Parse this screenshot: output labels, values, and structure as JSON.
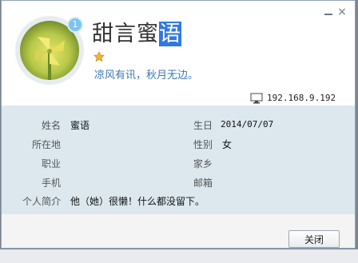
{
  "window": {
    "close_symbol": "×"
  },
  "profile": {
    "level": "1",
    "nickname_prefix": "甜言蜜",
    "nickname_highlighted": "语",
    "signature": "凉风有讯，秋月无边。",
    "ip": "192.168.9.192"
  },
  "fields": {
    "name_label": "姓名",
    "name_value": "蜜语",
    "location_label": "所在地",
    "location_value": "",
    "job_label": "职业",
    "job_value": "",
    "phone_label": "手机",
    "phone_value": "",
    "intro_label": "个人简介",
    "intro_value": "他（她）很懒！什么都没留下。",
    "birthday_label": "生日",
    "birthday_value": "2014/07/07",
    "gender_label": "性别",
    "gender_value": "女",
    "hometown_label": "家乡",
    "hometown_value": "",
    "email_label": "邮箱",
    "email_value": ""
  },
  "footer": {
    "close_label": "关闭"
  },
  "colors": {
    "panel_bg": "#dce8ee",
    "signature": "#3c78b5",
    "highlight": "#3178e4"
  }
}
